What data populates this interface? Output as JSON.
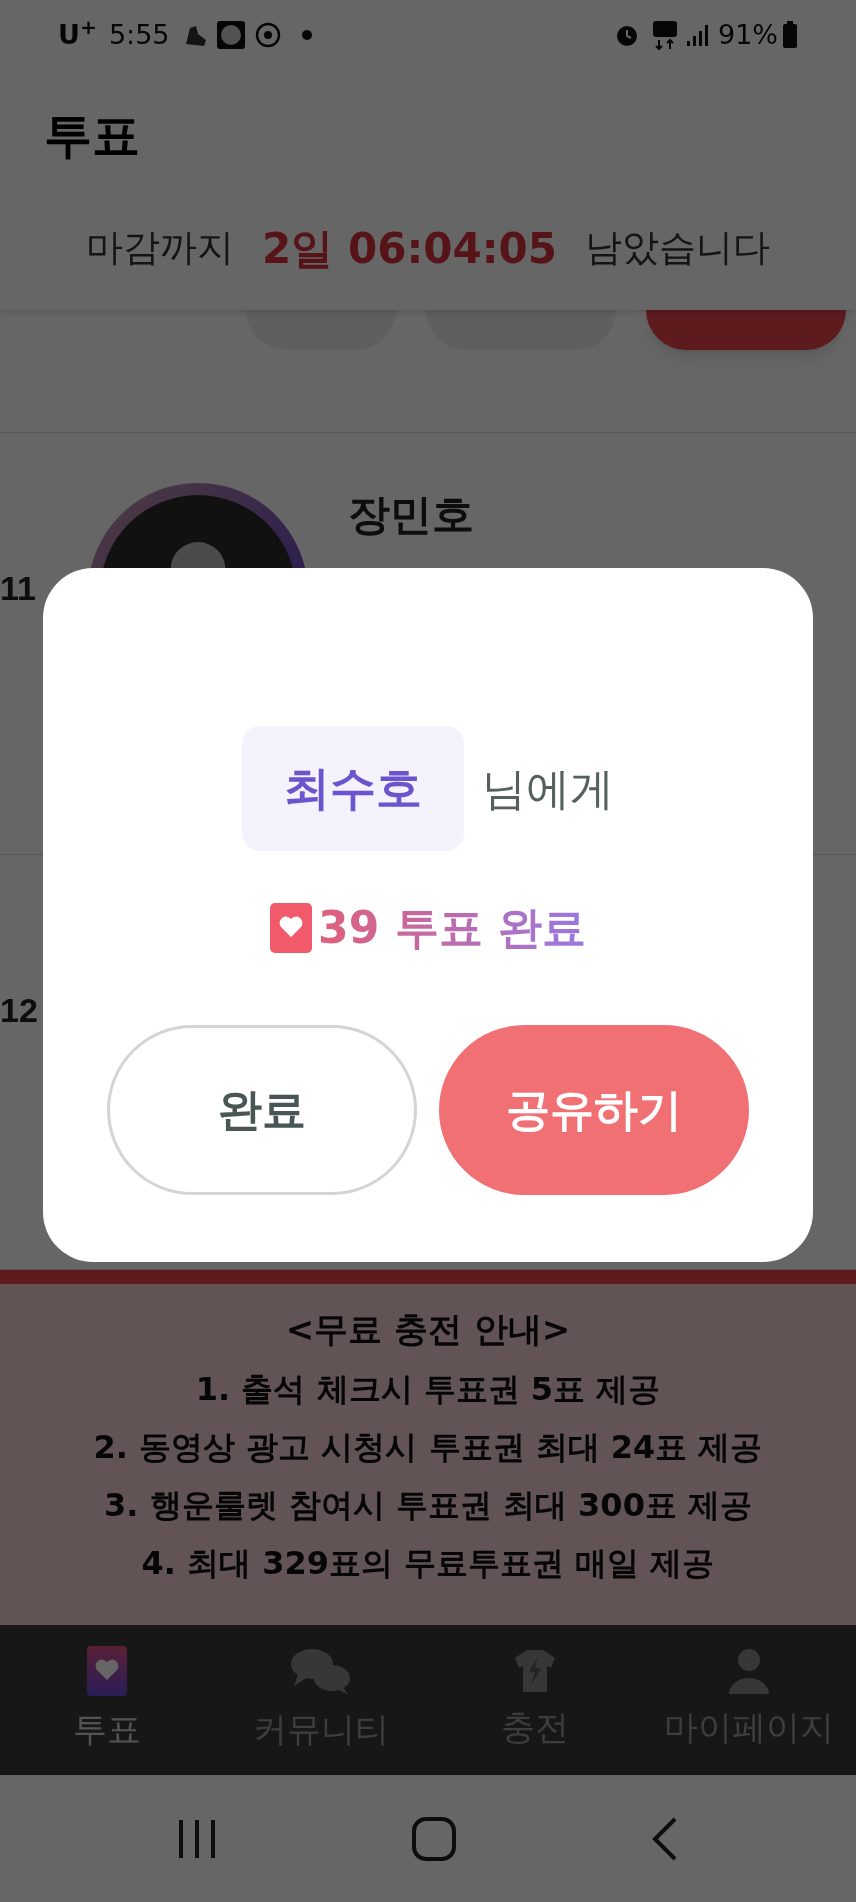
{
  "status_bar": {
    "carrier": "U$^{+}$",
    "time": "5:55",
    "battery": "91%"
  },
  "header": {
    "title": "투표"
  },
  "countdown": {
    "prefix": "마감까지",
    "time": "2일 06:04:05",
    "suffix": "남았습니다"
  },
  "candidates": [
    {
      "rank": "11",
      "name": "장민호"
    },
    {
      "rank": "12"
    }
  ],
  "promo": {
    "title": "<무료 충전 안내>",
    "lines": [
      "1. 출석 체크시 투표권 5표 제공",
      "2. 동영상 광고 시청시 투표권 최대 24표 제공",
      "3. 행운룰렛 참여시 투표권 최대 300표 제공",
      "4. 최대 329표의 무료투표권 매일 제공"
    ]
  },
  "nav": [
    {
      "label": "투표",
      "kind": "vote",
      "selected": true
    },
    {
      "label": "커뮤니티",
      "kind": "community",
      "selected": false
    },
    {
      "label": "충전",
      "kind": "charge",
      "selected": false
    },
    {
      "label": "마이페이지",
      "kind": "mypage",
      "selected": false
    }
  ],
  "modal": {
    "name": "최수호",
    "suffix": "님에게",
    "message": "39 투표 완료",
    "buttons": [
      {
        "label": "완료",
        "kind": "secondary"
      },
      {
        "label": "공유하기",
        "kind": "primary"
      }
    ]
  }
}
